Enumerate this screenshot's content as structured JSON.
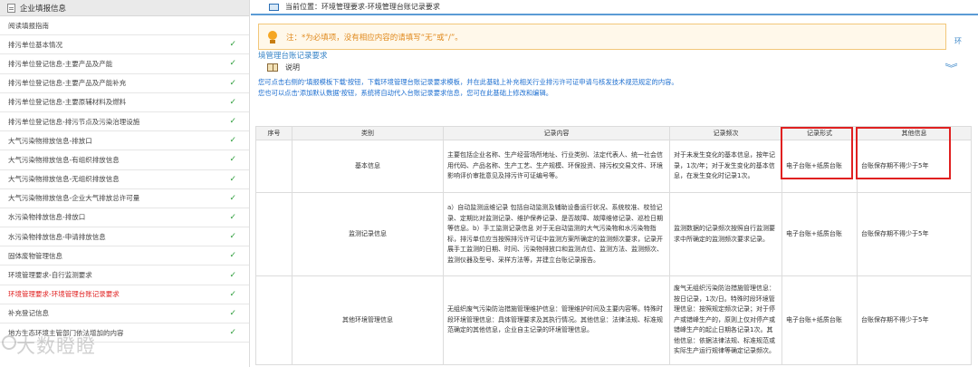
{
  "sidebar": {
    "title": "企业填报信息",
    "items": [
      {
        "label": "阅读填报指南",
        "checked": false
      },
      {
        "label": "排污单位基本情况",
        "checked": true
      },
      {
        "label": "排污单位登记信息-主要产品及产能",
        "checked": true
      },
      {
        "label": "排污单位登记信息-主要产品及产能补充",
        "checked": true
      },
      {
        "label": "排污单位登记信息-主要原辅材料及燃料",
        "checked": true
      },
      {
        "label": "排污单位登记信息-排污节点及污染治理设施",
        "checked": true
      },
      {
        "label": "大气污染物排放信息-排放口",
        "checked": true
      },
      {
        "label": "大气污染物排放信息-有组织排放信息",
        "checked": true
      },
      {
        "label": "大气污染物排放信息-无组织排放信息",
        "checked": true
      },
      {
        "label": "大气污染物排放信息-企业大气排放总许可量",
        "checked": true
      },
      {
        "label": "水污染物排放信息-排放口",
        "checked": true
      },
      {
        "label": "水污染物排放信息-申请排放信息",
        "checked": true
      },
      {
        "label": "固体废物管理信息",
        "checked": true
      },
      {
        "label": "环境管理要求-自行监测要求",
        "checked": true
      },
      {
        "label": "环境管理要求-环境管理台账记录要求",
        "checked": true,
        "active": true
      },
      {
        "label": "补充登记信息",
        "checked": true
      },
      {
        "label": "地方生态环境主管部门依法增加的内容",
        "checked": true
      }
    ],
    "check_mark": "✓",
    "watermark": "大数瞪瞪"
  },
  "breadcrumb": "当前位置：环境管理要求-环境管理台账记录要求",
  "notice": {
    "text": "注：*为必填项，没有相应内容的请填写“无”或“/”。",
    "tail": "环"
  },
  "section_title": "境管理台账记录要求",
  "explain_label": "说明",
  "collapse_icon": "»",
  "instructions": [
    "您可点击右侧的'填报模板下载'按钮，下载环境管理台账记录要求模板，并在此基础上补充相关行业排污许可证申请与核发技术规范规定的内容。",
    "您也可以点击'添加默认数据'按钮，系统将自动代入台账记录要求信息，您可在此基础上修改和编辑。"
  ],
  "table": {
    "headers": [
      "序号",
      "类别",
      "记录内容",
      "记录频次",
      "记录形式",
      "其他信息"
    ],
    "rows": [
      {
        "no": "",
        "category": "基本信息",
        "content": "主要包括企业名称、生产经营场所地址、行业类别、法定代表人、统一社会信用代码、产品名称、生产工艺、生产规模、环保投资、排污权交易文件、环境影响评价审批意见及排污许可证编号等。",
        "frequency": "对于未发生变化的基本信息，按年记录，1次/年；对于发生变化的基本信息，在发生变化时记录1次。",
        "form": "电子台账+纸质台账",
        "other": "台账保存期不得少于5年"
      },
      {
        "no": "",
        "category": "监测记录信息",
        "content": "a）自动监测运维记录 包括自动监测及辅助设备运行状况、系统校准、校验记录、定期比对监测记录、维护保养记录、是否故障、故障维修记录、巡检日期等信息。b）手工监测记录信息 对于无自动监测的大气污染物和水污染物指标，排污单位应当按照排污许可证中监测方案所确定的监测频次要求，记录开展手工监测的日期、时间、污染物排放口和监测点位、监测方法、监测频次、监测仪器及型号、采样方法等，并建立台账记录报告。",
        "frequency": "监测数据的记录频次按照自行监测要求中所确定的监测频次要求记录。",
        "form": "电子台账+纸质台账",
        "other": "台账保存期不得少于5年"
      },
      {
        "no": "",
        "category": "其他环境管理信息",
        "content": "无组织废气污染防治措施管理维护信息：管理维护时间及主要内容等。特殊时段环境管理信息：具体管理要求及其执行情况。其他信息：法律法规、标准规范确定的其他信息，企业自主记录的环境管理信息。",
        "frequency": "废气无组织污染防治措施管理信息：按日记录，1次/日。特殊时段环境管理信息：按照规定频次记录；对于停产或错峰生产的，原则上仅对停产或错峰生产的起止日期各记录1次。其他信息：依据法律法规、标准规范或实际生产运行规律等确定记录频次。",
        "form": "电子台账+纸质台账",
        "other": "台账保存期不得少于5年"
      }
    ],
    "last_row_preview": "a）自动监测运维记录..."
  }
}
